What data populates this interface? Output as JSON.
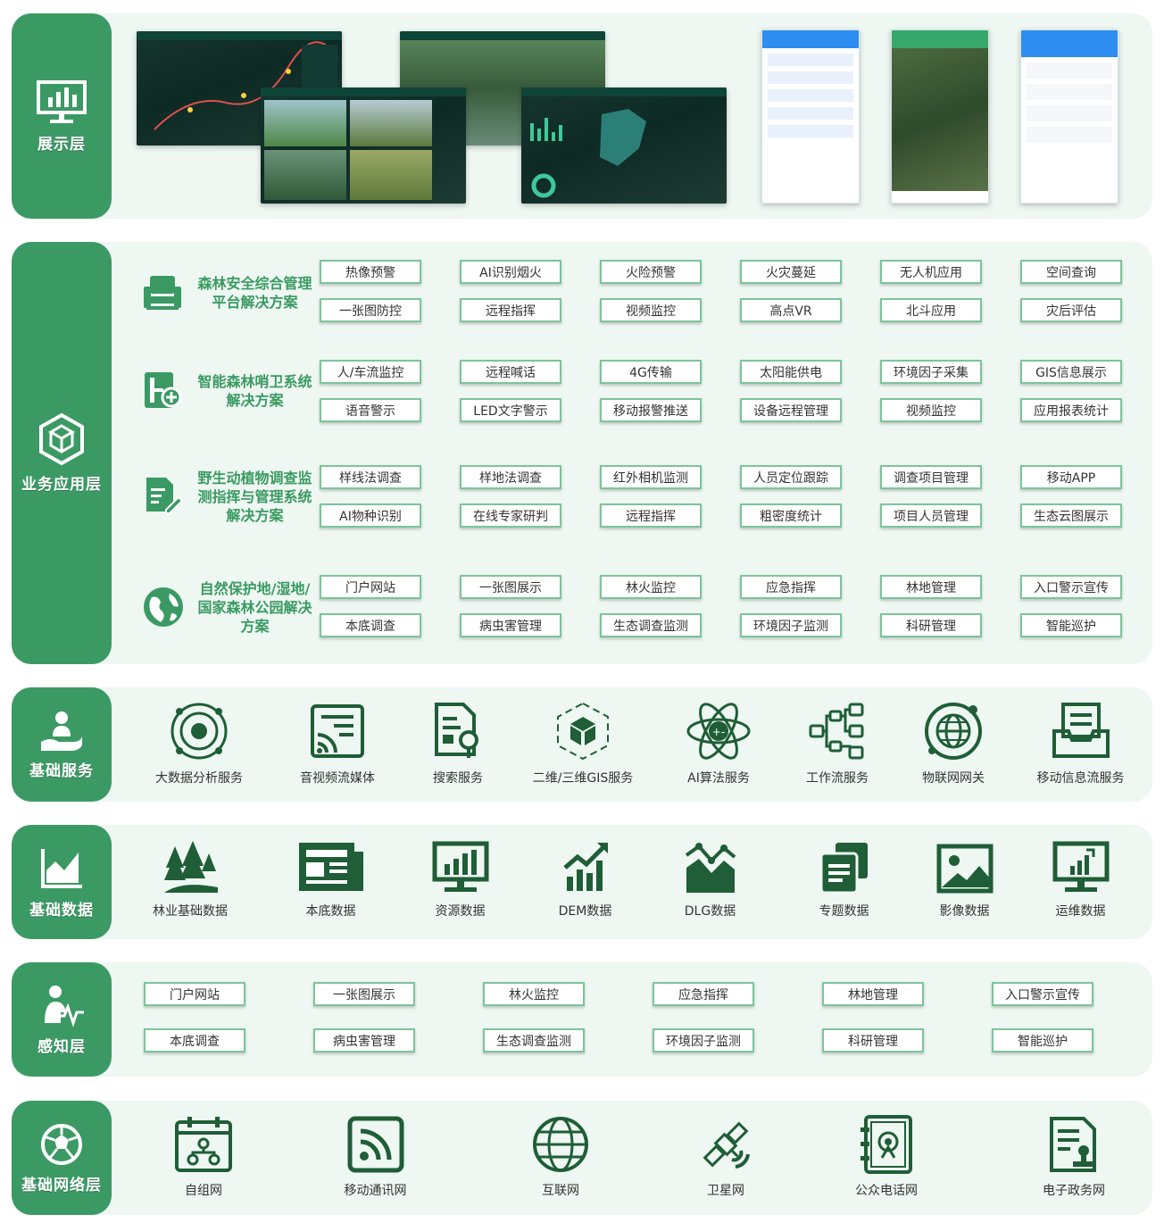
{
  "layers": {
    "display": {
      "title": "展示层"
    },
    "business": {
      "title": "业务应用层"
    },
    "base_service": {
      "title": "基础服务"
    },
    "base_data": {
      "title": "基础数据"
    },
    "perception": {
      "title": "感知层"
    },
    "network": {
      "title": "基础网络层"
    }
  },
  "solutions": [
    {
      "title": "森林安全综合管理平台解决方案",
      "tags": [
        "热像预警",
        "AI识别烟火",
        "火险预警",
        "火灾蔓延",
        "无人机应用",
        "空间查询",
        "一张图防控",
        "远程指挥",
        "视频监控",
        "高点VR",
        "北斗应用",
        "灾后评估"
      ]
    },
    {
      "title": "智能森林哨卫系统解决方案",
      "tags": [
        "人/车流监控",
        "远程喊话",
        "4G传输",
        "太阳能供电",
        "环境因子采集",
        "GIS信息展示",
        "语音警示",
        "LED文字警示",
        "移动报警推送",
        "设备远程管理",
        "视频监控",
        "应用报表统计"
      ]
    },
    {
      "title": "野生动植物调查监测指挥与管理系统解决方案",
      "tags": [
        "样线法调查",
        "样地法调查",
        "红外相机监测",
        "人员定位跟踪",
        "调查项目管理",
        "移动APP",
        "AI物种识别",
        "在线专家研判",
        "远程指挥",
        "粗密度统计",
        "项目人员管理",
        "生态云图展示"
      ]
    },
    {
      "title": "自然保护地/湿地/国家森林公园解决方案",
      "tags": [
        "门户网站",
        "一张图展示",
        "林火监控",
        "应急指挥",
        "林地管理",
        "入口警示宣传",
        "本底调查",
        "病虫害管理",
        "生态调查监测",
        "环境因子监测",
        "科研管理",
        "智能巡护"
      ]
    }
  ],
  "services": [
    "大数据分析服务",
    "音视频流媒体",
    "搜索服务",
    "二维/三维GIS服务",
    "AI算法服务",
    "工作流服务",
    "物联网网关",
    "移动信息流服务"
  ],
  "data_items": [
    "林业基础数据",
    "本底数据",
    "资源数据",
    "DEM数据",
    "DLG数据",
    "专题数据",
    "影像数据",
    "运维数据"
  ],
  "perception_tags": [
    "门户网站",
    "一张图展示",
    "林火监控",
    "应急指挥",
    "林地管理",
    "入口警示宣传",
    "本底调查",
    "病虫害管理",
    "生态调查监测",
    "环境因子监测",
    "科研管理",
    "智能巡护"
  ],
  "networks": [
    "自组网",
    "移动通讯网",
    "互联网",
    "卫星网",
    "公众电话网",
    "电子政务网"
  ],
  "icons": {
    "display": "monitor-chart-icon",
    "business": "cube-hexagon-icon",
    "base_service": "hand-user-icon",
    "base_data": "area-chart-icon",
    "perception": "person-pulse-icon",
    "network": "globe-ball-icon"
  },
  "colors": {
    "accent": "#3b9a64",
    "panel": "#eef7f2",
    "icon": "#1f5e36",
    "tag_border": "#7cc49a"
  }
}
